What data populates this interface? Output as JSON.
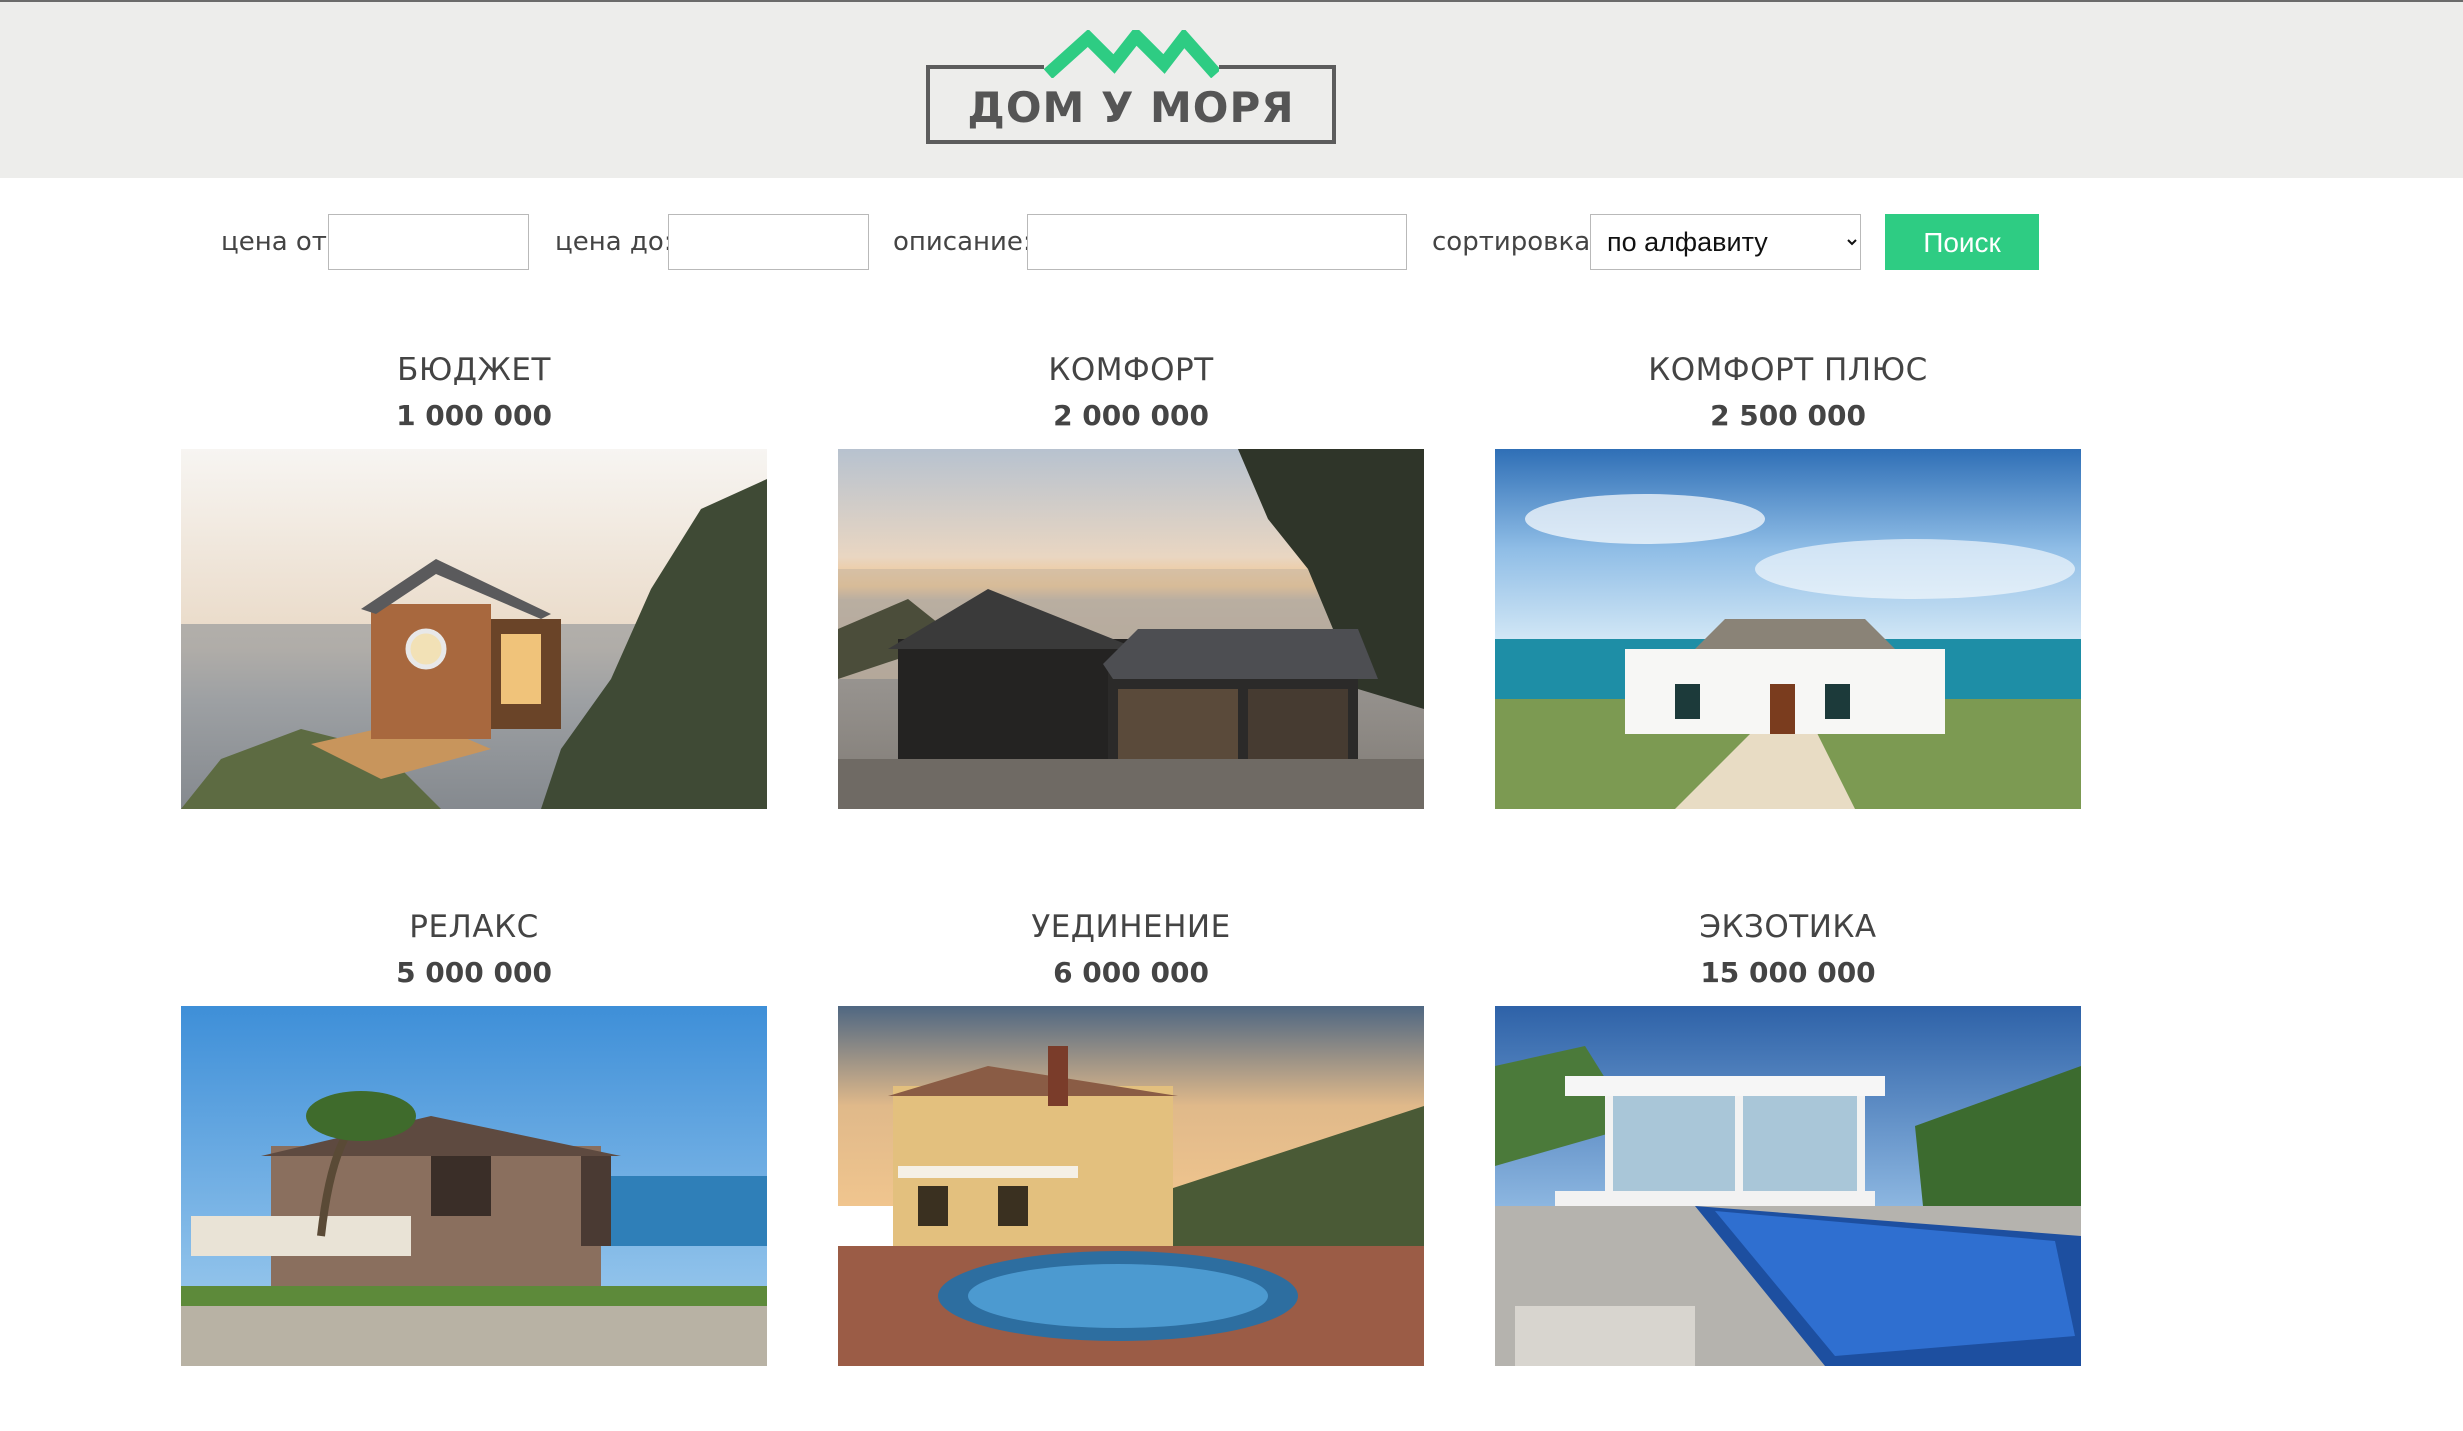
{
  "header": {
    "logo_text": "ДОМ У МОРЯ",
    "logo_color_accent": "#2ecc83",
    "background": "#ededeb"
  },
  "search": {
    "price_from_label": "цена от:",
    "price_from_value": "",
    "price_to_label": "цена до:",
    "price_to_value": "",
    "description_label": "описание:",
    "description_value": "",
    "sort_label": "сортировка:",
    "sort_selected": "по алфавиту",
    "button_label": "Поиск",
    "button_color": "#2ecc83"
  },
  "listings": [
    {
      "title": "БЮДЖЕТ",
      "price": "1 000 000",
      "image": "wooden cabin on cliff at sunset"
    },
    {
      "title": "КОМФОРТ",
      "price": "2 000 000",
      "image": "dark house by the lake at dusk"
    },
    {
      "title": "КОМФОРТ ПЛЮС",
      "price": "2 500 000",
      "image": "white cottage by the sea"
    },
    {
      "title": "РЕЛАКС",
      "price": "5 000 000",
      "image": "villa with palms by the ocean"
    },
    {
      "title": "УЕДИНЕНИЕ",
      "price": "6 000 000",
      "image": "yellow house with pool at sunset"
    },
    {
      "title": "ЭКЗОТИКА",
      "price": "15 000 000",
      "image": "modern white villa with infinity pool"
    }
  ]
}
